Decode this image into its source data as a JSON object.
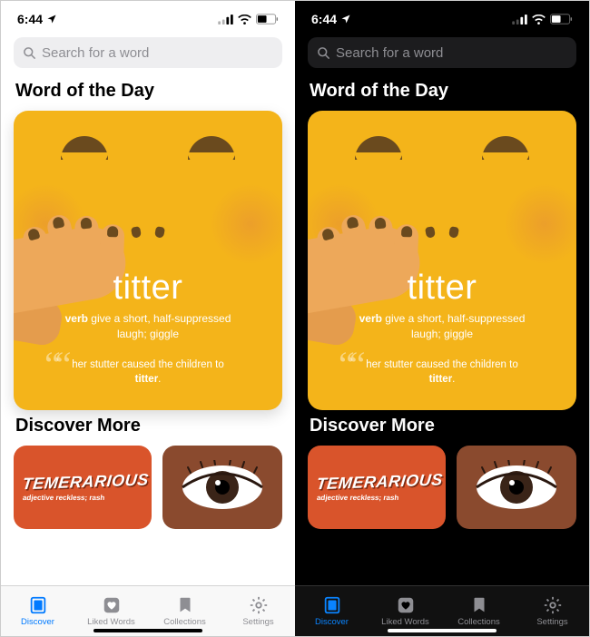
{
  "status": {
    "time": "6:44",
    "location_arrow": true
  },
  "search": {
    "placeholder": "Search for a word"
  },
  "sections": {
    "wotd_title": "Word of the Day",
    "discover_title": "Discover More"
  },
  "wotd": {
    "word": "titter",
    "pos": "verb",
    "definition": "give a short, half-suppressed laugh; giggle",
    "example_pre": "her stutter caused the children to ",
    "example_word": "titter",
    "example_post": "."
  },
  "discover": {
    "items": [
      {
        "word": "TEMERARIOUS",
        "pos": "adjective",
        "definition": "reckless; rash"
      },
      {
        "word": "",
        "icon": "eye"
      }
    ]
  },
  "tabs": [
    {
      "id": "discover",
      "label": "Discover",
      "active": true
    },
    {
      "id": "liked",
      "label": "Liked Words",
      "active": false
    },
    {
      "id": "collections",
      "label": "Collections",
      "active": false
    },
    {
      "id": "settings",
      "label": "Settings",
      "active": false
    }
  ],
  "colors": {
    "wotd_bg": "#f4b41a",
    "accent_light": "#007aff",
    "accent_dark": "#0a84ff"
  }
}
